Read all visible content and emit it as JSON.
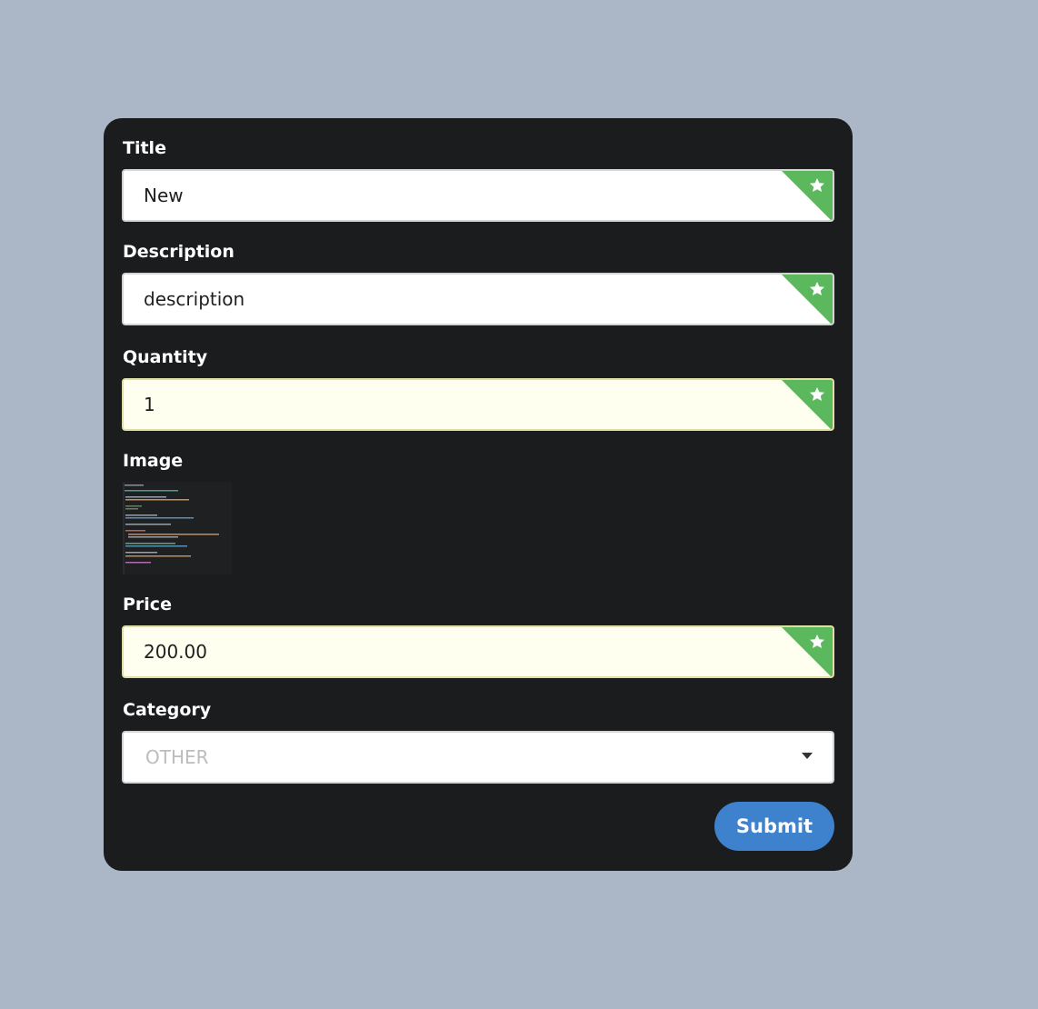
{
  "form": {
    "fields": {
      "title": {
        "label": "Title",
        "value": "New"
      },
      "description": {
        "label": "Description",
        "value": "description"
      },
      "quantity": {
        "label": "Quantity",
        "value": "1"
      },
      "image": {
        "label": "Image"
      },
      "price": {
        "label": "Price",
        "value": "200.00"
      },
      "category": {
        "label": "Category",
        "selected": "OTHER"
      }
    },
    "submit_label": "Submit"
  },
  "icons": {
    "required_marker": "star-icon",
    "select_caret": "caret-down-icon"
  },
  "colors": {
    "page_background": "#abb7c7",
    "card_background": "#1b1c1e",
    "required_corner": "#5cb85c",
    "submit_button": "#3e81cd",
    "autofill_background": "#fffff0"
  }
}
